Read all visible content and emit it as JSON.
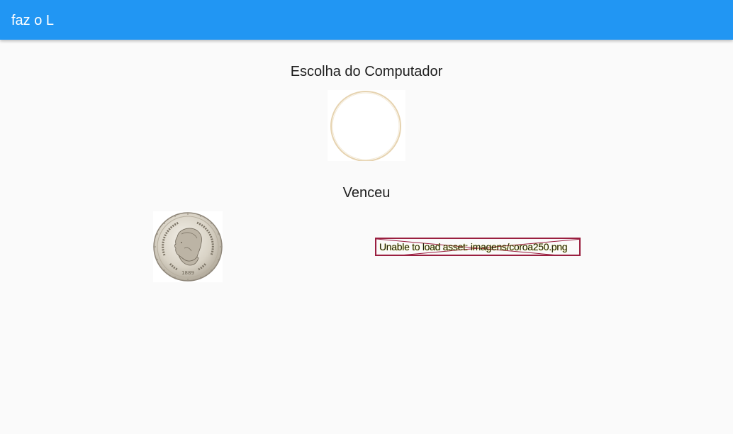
{
  "appbar": {
    "title": "faz o L",
    "background_color": "#2196f3"
  },
  "main": {
    "computer_choice_label": "Escolha do Computador",
    "computer_choice_image": "coin-blank-icon",
    "result_label": "Venceu",
    "options": [
      {
        "image": "coin-heads-portrait-icon",
        "year_text": "1889"
      },
      {
        "image": "broken-image-icon",
        "error_text": "Unable to load asset: imagens/coroa250.png"
      }
    ]
  }
}
